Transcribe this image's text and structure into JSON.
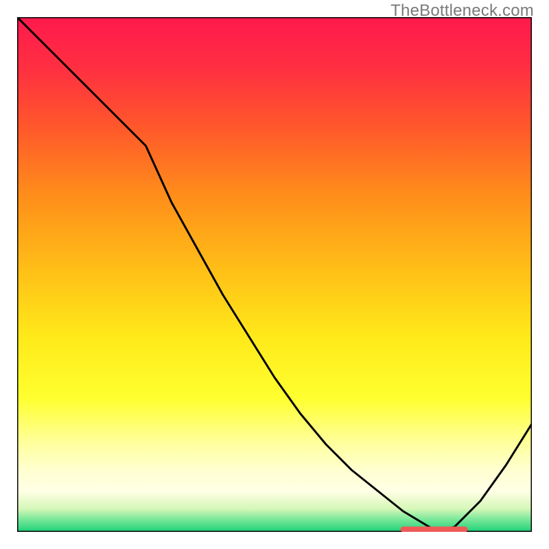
{
  "watermark": "TheBottleneck.com",
  "colors": {
    "gradient_stops": [
      {
        "offset": 0.0,
        "color": "#ff1a4d"
      },
      {
        "offset": 0.1,
        "color": "#ff2f41"
      },
      {
        "offset": 0.22,
        "color": "#ff5a2a"
      },
      {
        "offset": 0.35,
        "color": "#ff8f1a"
      },
      {
        "offset": 0.5,
        "color": "#ffc217"
      },
      {
        "offset": 0.62,
        "color": "#ffe91a"
      },
      {
        "offset": 0.74,
        "color": "#ffff2f"
      },
      {
        "offset": 0.83,
        "color": "#ffffa0"
      },
      {
        "offset": 0.88,
        "color": "#ffffd0"
      },
      {
        "offset": 0.92,
        "color": "#ffffe6"
      },
      {
        "offset": 0.955,
        "color": "#d6f7b8"
      },
      {
        "offset": 0.975,
        "color": "#7de89a"
      },
      {
        "offset": 1.0,
        "color": "#1dd27a"
      }
    ],
    "curve": "#000000",
    "marker": "#ef5a57",
    "frame": "#000000"
  },
  "chart_data": {
    "type": "line",
    "title": "",
    "xlabel": "",
    "ylabel": "",
    "x": [
      0,
      5,
      10,
      15,
      20,
      25,
      30,
      35,
      40,
      45,
      50,
      55,
      60,
      65,
      70,
      75,
      80,
      82,
      85,
      90,
      95,
      100
    ],
    "values": [
      100,
      95,
      90,
      85,
      80,
      75,
      64,
      55,
      46,
      38,
      30,
      23,
      17,
      12,
      8,
      4,
      1,
      0,
      1,
      6,
      13,
      21
    ],
    "xlim": [
      0,
      100
    ],
    "ylim": [
      0,
      100
    ],
    "grid": false,
    "marker": {
      "x_start": 75,
      "x_end": 87,
      "y": 0.5
    }
  }
}
